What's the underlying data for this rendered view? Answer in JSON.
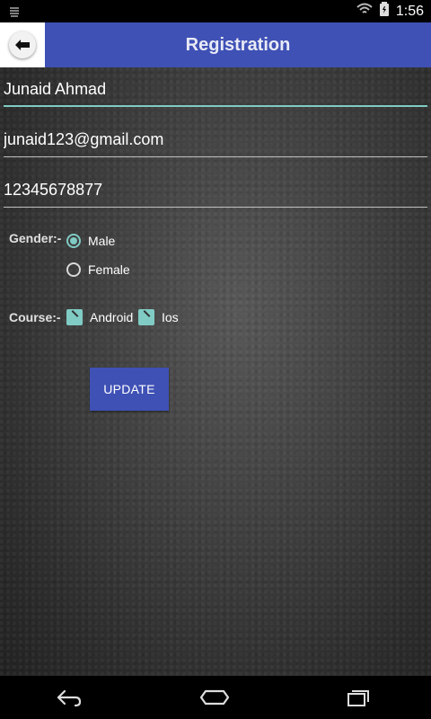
{
  "status_bar": {
    "time": "1:56"
  },
  "header": {
    "title": "Registration"
  },
  "form": {
    "name_value": "Junaid Ahmad",
    "email_value": "junaid123@gmail.com",
    "phone_value": "12345678877",
    "gender_label": "Gender:-",
    "gender_options": [
      "Male",
      "Female"
    ],
    "gender_selected": "Male",
    "course_label": "Course:-",
    "course_options": [
      "Android",
      "Ios"
    ],
    "course_checked": [
      "Android",
      "Ios"
    ],
    "update_label": "UPDATE"
  },
  "colors": {
    "primary": "#3f51b5",
    "accent": "#80cbc4"
  },
  "icons": {
    "back": "arrow-left-icon",
    "nav_back": "nav-back-icon",
    "nav_home": "nav-home-icon",
    "nav_recents": "nav-recents-icon"
  }
}
